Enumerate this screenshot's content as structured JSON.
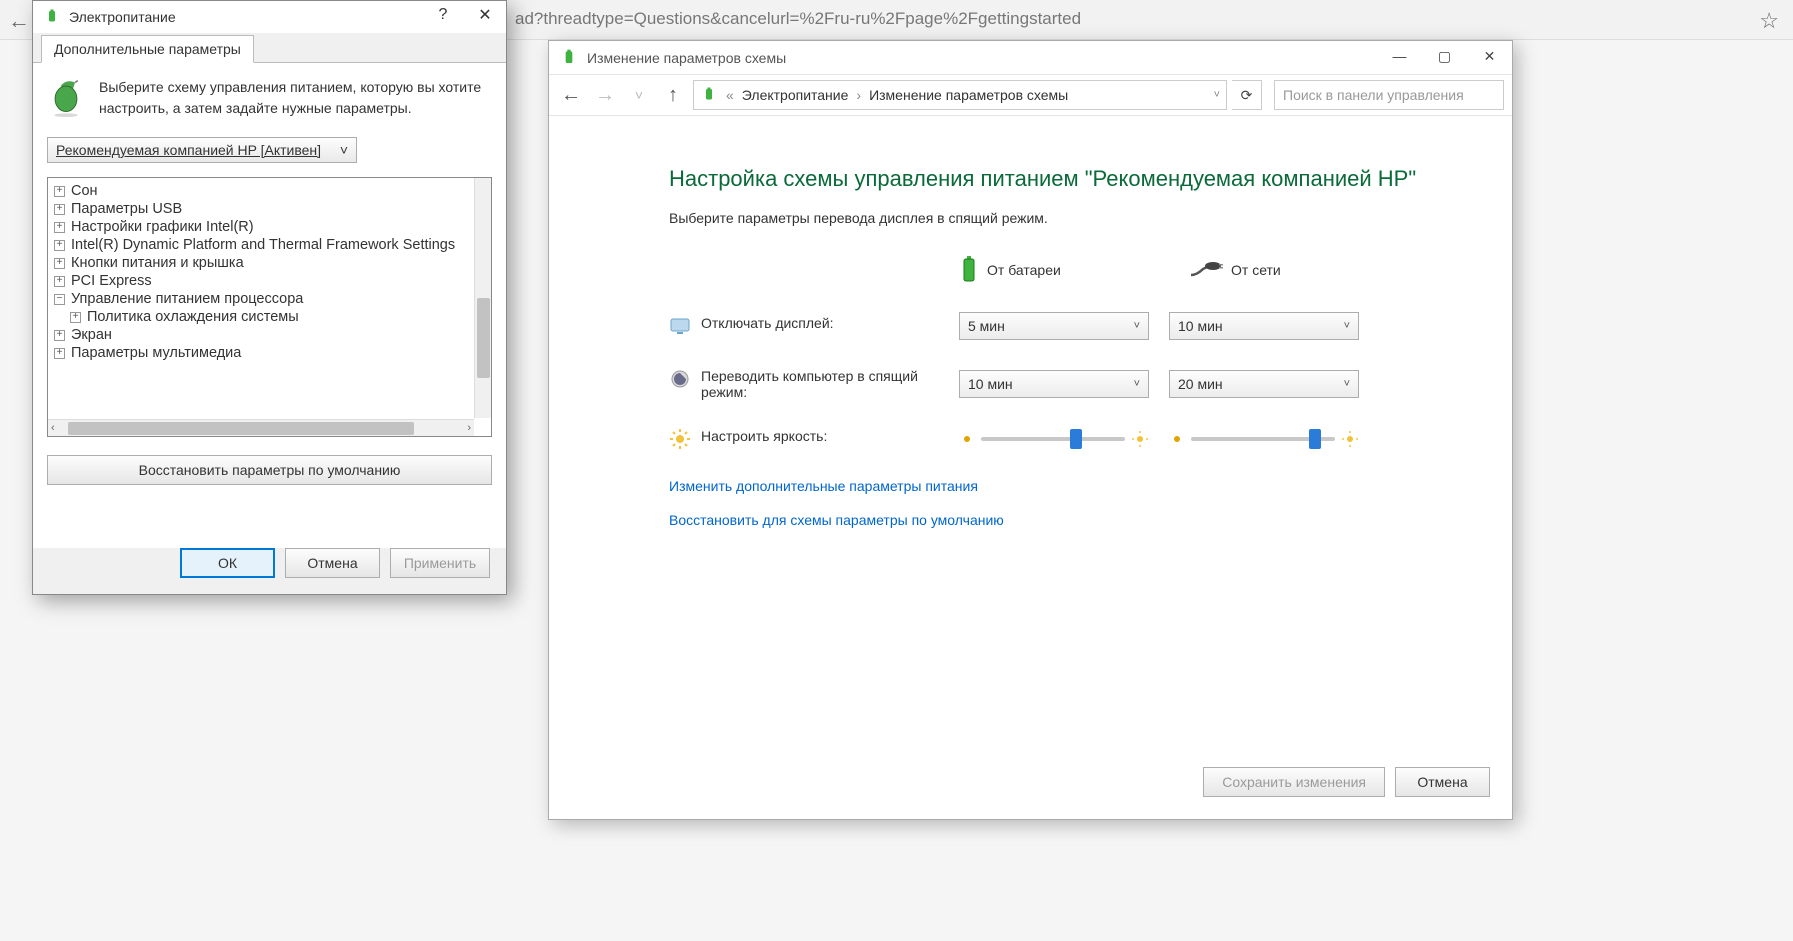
{
  "browser": {
    "url_fragment": "ad?threadtype=Questions&cancelurl=%2Fru-ru%2Fpage%2Fgettingstarted"
  },
  "dialog": {
    "title": "Электропитание",
    "tab": "Дополнительные параметры",
    "intro": "Выберите схему управления питанием, которую вы хотите настроить, а затем задайте нужные параметры.",
    "scheme": "Рекомендуемая компанией HP [Активен]",
    "tree": {
      "n1": "Сон",
      "n2": "Параметры USB",
      "n3": "Настройки графики Intel(R)",
      "n4": "Intel(R) Dynamic Platform and Thermal Framework Settings",
      "n5": "Кнопки питания и крышка",
      "n6": "PCI Express",
      "n7": "Управление питанием процессора",
      "n7a": "Политика охлаждения системы",
      "n8": "Экран",
      "n9": "Параметры мультимедиа"
    },
    "restore": "Восстановить параметры по умолчанию",
    "ok": "ОК",
    "cancel": "Отмена",
    "apply": "Применить"
  },
  "plan": {
    "win_title": "Изменение параметров схемы",
    "crumb_power": "Электропитание",
    "crumb_edit": "Изменение параметров схемы",
    "search_placeholder": "Поиск в панели управления",
    "title": "Настройка схемы управления питанием \"Рекомендуемая компанией HP\"",
    "subtitle": "Выберите параметры перевода дисплея в спящий режим.",
    "col_battery": "От батареи",
    "col_ac": "От сети",
    "row_display": "Отключать дисплей:",
    "row_sleep": "Переводить компьютер в спящий режим:",
    "row_brightness": "Настроить яркость:",
    "v_display_bat": "5 мин",
    "v_display_ac": "10 мин",
    "v_sleep_bat": "10 мин",
    "v_sleep_ac": "20 мин",
    "link_adv": "Изменить дополнительные параметры питания",
    "link_restore": "Восстановить для схемы параметры по умолчанию",
    "btn_save": "Сохранить изменения",
    "btn_cancel": "Отмена"
  }
}
